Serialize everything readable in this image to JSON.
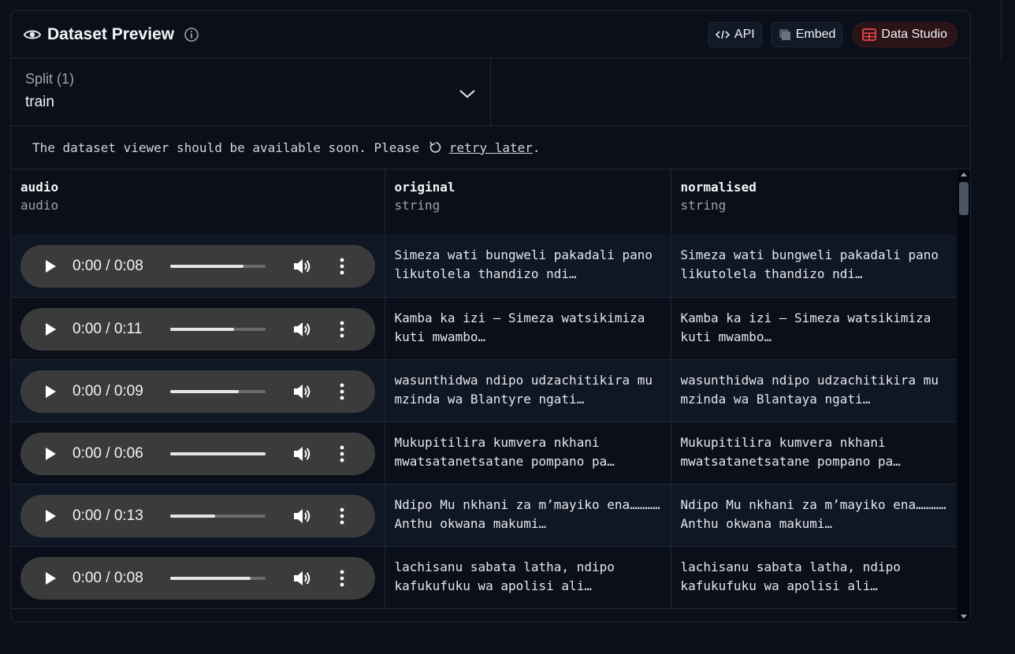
{
  "header": {
    "title": "Dataset Preview",
    "api_label": "API",
    "embed_label": "Embed",
    "studio_label": "Data Studio"
  },
  "split": {
    "label": "Split (1)",
    "value": "train"
  },
  "notice": {
    "text": "The dataset viewer should be available soon. Please ",
    "link": "retry later",
    "suffix": "."
  },
  "columns": [
    {
      "name": "audio",
      "type": "audio"
    },
    {
      "name": "original",
      "type": "string"
    },
    {
      "name": "normalised",
      "type": "string"
    }
  ],
  "rows": [
    {
      "time": "0:00 / 0:08",
      "progress": 0.77,
      "original": "Simeza wati bungweli pakadali pano likutolela thandizo ndi…",
      "normalised": "Simeza wati bungweli pakadali pano likutolela thandizo ndi…"
    },
    {
      "time": "0:00 / 0:11",
      "progress": 0.67,
      "original": "Kamba ka izi – Simeza watsikimiza kuti mwambo…",
      "normalised": "Kamba ka izi – Simeza watsikimiza kuti mwambo…"
    },
    {
      "time": "0:00 / 0:09",
      "progress": 0.72,
      "original": "wasunthidwa ndipo udzachitikira mu mzinda wa Blantyre ngati…",
      "normalised": "wasunthidwa ndipo udzachitikira mu mzinda wa Blantaya ngati…"
    },
    {
      "time": "0:00 / 0:06",
      "progress": 1.0,
      "original": "Mukupitilira kumvera nkhani mwatsatanetsatane pompano pa…",
      "normalised": "Mukupitilira kumvera nkhani mwatsatanetsatane pompano pa…"
    },
    {
      "time": "0:00 / 0:13",
      "progress": 0.47,
      "original": "Ndipo Mu nkhani za m’mayiko ena………… Anthu okwana makumi…",
      "normalised": "Ndipo Mu nkhani za m’mayiko ena………… Anthu okwana makumi…"
    },
    {
      "time": "0:00 / 0:08",
      "progress": 0.84,
      "original": "lachisanu sabata latha, ndipo kafukufuku wa apolisi ali…",
      "normalised": "lachisanu sabata latha, ndipo kafukufuku wa apolisi ali…"
    }
  ]
}
